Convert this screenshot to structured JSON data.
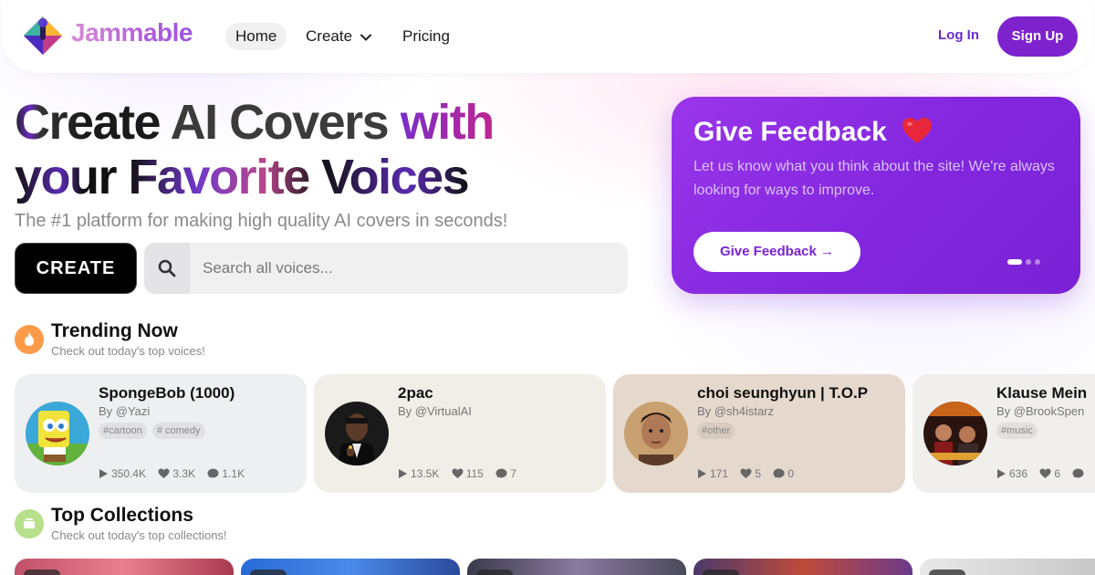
{
  "nav": {
    "brand": "Jammable",
    "home": "Home",
    "create": "Create",
    "pricing": "Pricing",
    "login": "Log In",
    "signup": "Sign Up"
  },
  "hero": {
    "line1a": "Create",
    "line1b": " AI Covers ",
    "line1c": "with",
    "line2a": "your ",
    "line2b": "Favorite ",
    "line2c": "Voices",
    "subtitle": "The #1 platform for making high quality AI covers in seconds!",
    "create_label": "CREATE",
    "search_placeholder": "Search all voices..."
  },
  "feedback": {
    "title": "Give Feedback",
    "text": "Let us know what you think about the site! We're always looking for ways to improve.",
    "button": "Give Feedback →"
  },
  "trending": {
    "title": "Trending Now",
    "subtitle": "Check out today's top voices!",
    "cards": [
      {
        "name": "SpongeBob (1000)",
        "by": "By @Yazi",
        "tags": [
          "#cartoon",
          "# comedy"
        ],
        "plays": "350.4K",
        "likes": "3.3K",
        "comments": "1.1K",
        "bg": "#eeeff1"
      },
      {
        "name": "2pac",
        "by": "By @VirtualAI",
        "tags": [],
        "plays": "13.5K",
        "likes": "115",
        "comments": "7",
        "bg": "#f1eee8"
      },
      {
        "name": "choi seunghyun | T.O.P",
        "by": "By @sh4istarz",
        "tags": [
          "#other"
        ],
        "plays": "171",
        "likes": "5",
        "comments": "0",
        "bg": "#e5d8cd"
      },
      {
        "name": "Klause Mein",
        "by": "By @BrookSpen",
        "tags": [
          "#music"
        ],
        "plays": "636",
        "likes": "6",
        "comments": "",
        "bg": "#f1efec"
      }
    ]
  },
  "collections": {
    "title": "Top Collections",
    "subtitle": "Check out today's top collections!"
  },
  "colors": {
    "accent": "#7e22ce",
    "feedback_bg": "#8a2be2"
  }
}
